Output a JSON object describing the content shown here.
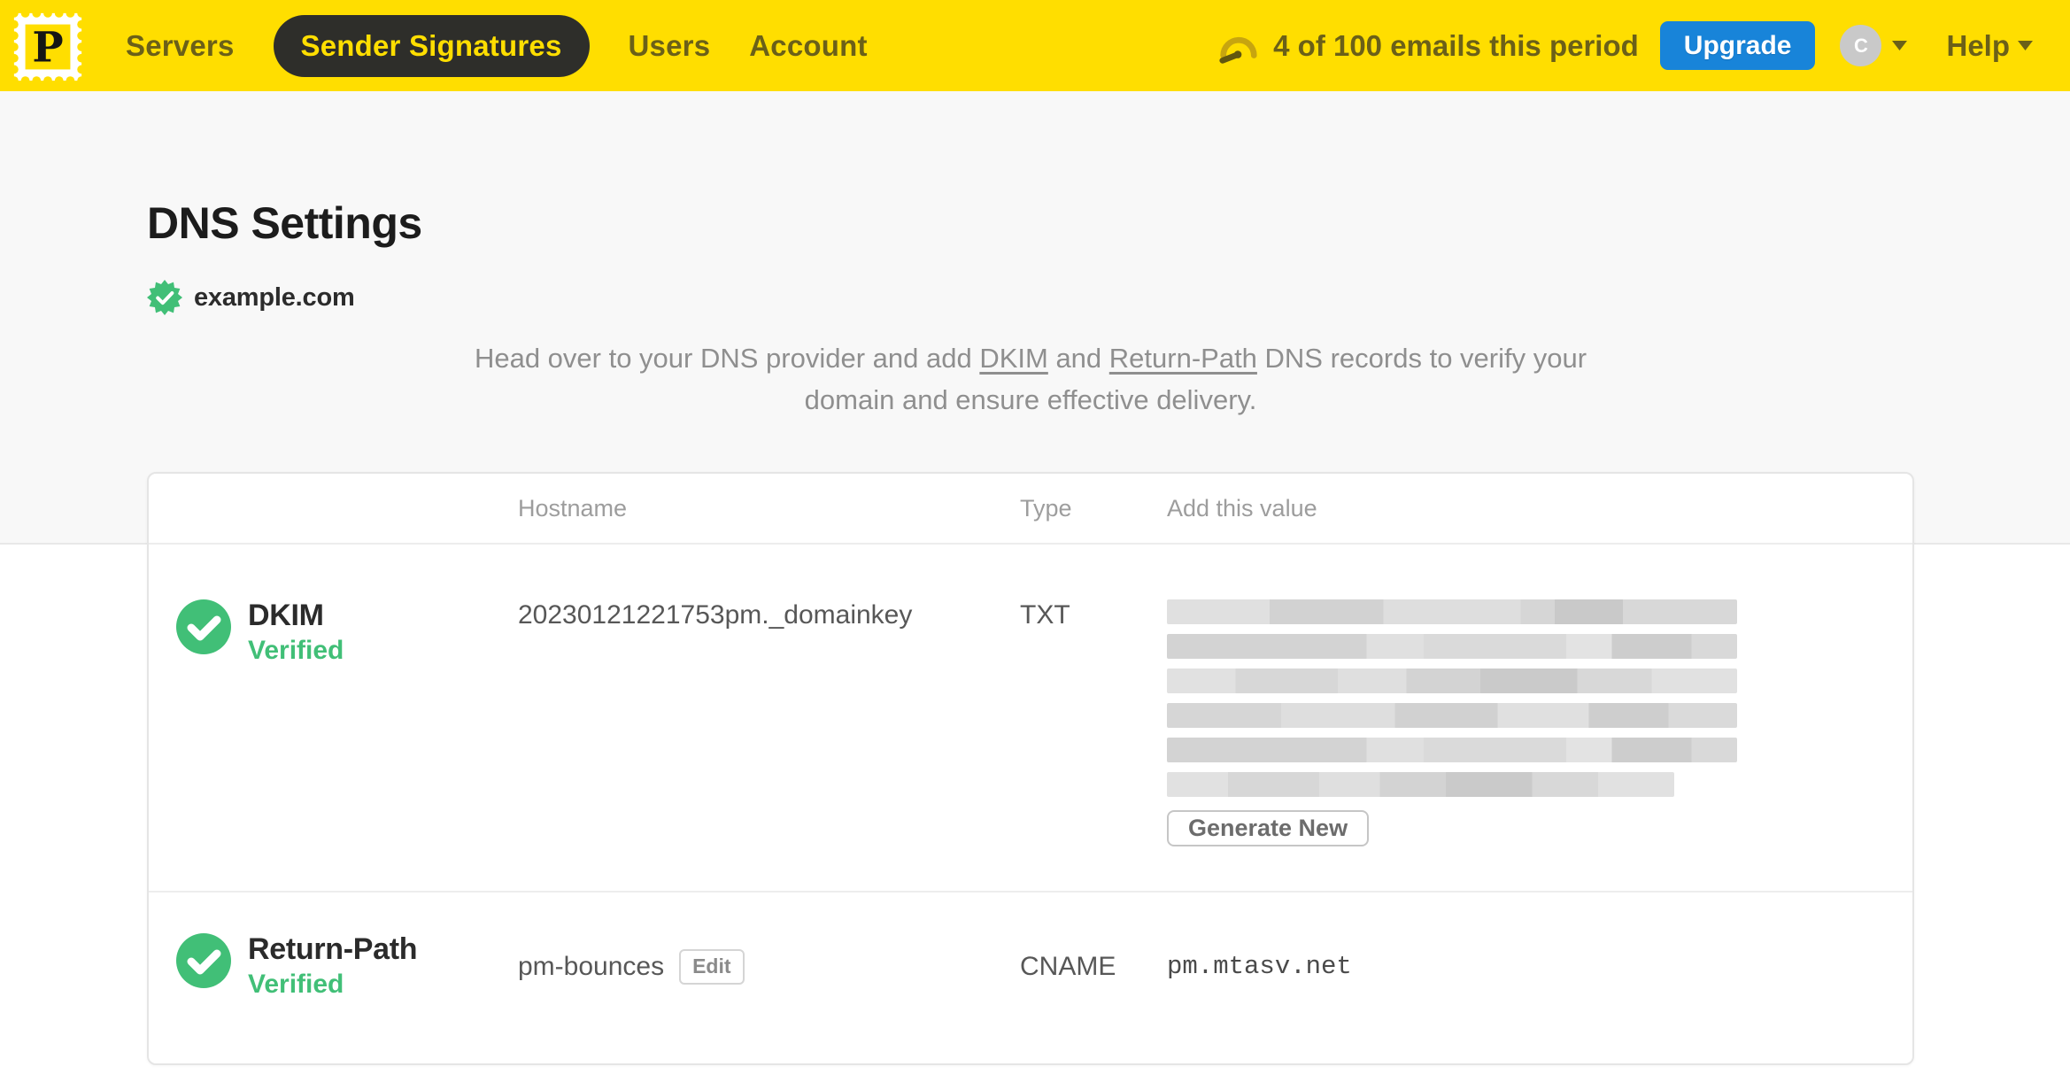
{
  "colors": {
    "yellow": "#FFDE00",
    "navtext": "#6b6018",
    "pill": "#2e2e2a",
    "blue": "#1884d9",
    "green": "#41bf77",
    "ink": "#1c1c1c",
    "muted": "#8f8f8f"
  },
  "nav": {
    "logo_letter": "P",
    "items": [
      {
        "label": "Servers",
        "active": false
      },
      {
        "label": "Sender Signatures",
        "active": true
      },
      {
        "label": "Users",
        "active": false
      },
      {
        "label": "Account",
        "active": false
      }
    ],
    "usage_text": "4 of 100 emails this period",
    "upgrade_label": "Upgrade",
    "avatar_initial": "C",
    "help_label": "Help"
  },
  "page": {
    "title": "DNS Settings",
    "domain": "example.com",
    "instructions": {
      "before": "Head over to your DNS provider and add ",
      "dkim_link": "DKIM",
      "between": " and ",
      "return_path_link": "Return-Path",
      "after": " DNS records to verify your domain and ensure effective delivery."
    }
  },
  "table": {
    "headers": {
      "hostname": "Hostname",
      "type": "Type",
      "value": "Add this value"
    },
    "rows": [
      {
        "name": "DKIM",
        "status": "Verified",
        "hostname": "20230121221753pm._domainkey",
        "type": "TXT",
        "value_redacted": true,
        "action_label": "Generate New"
      },
      {
        "name": "Return-Path",
        "status": "Verified",
        "hostname": "pm-bounces",
        "edit_label": "Edit",
        "type": "CNAME",
        "value": "pm.mtasv.net"
      }
    ]
  }
}
